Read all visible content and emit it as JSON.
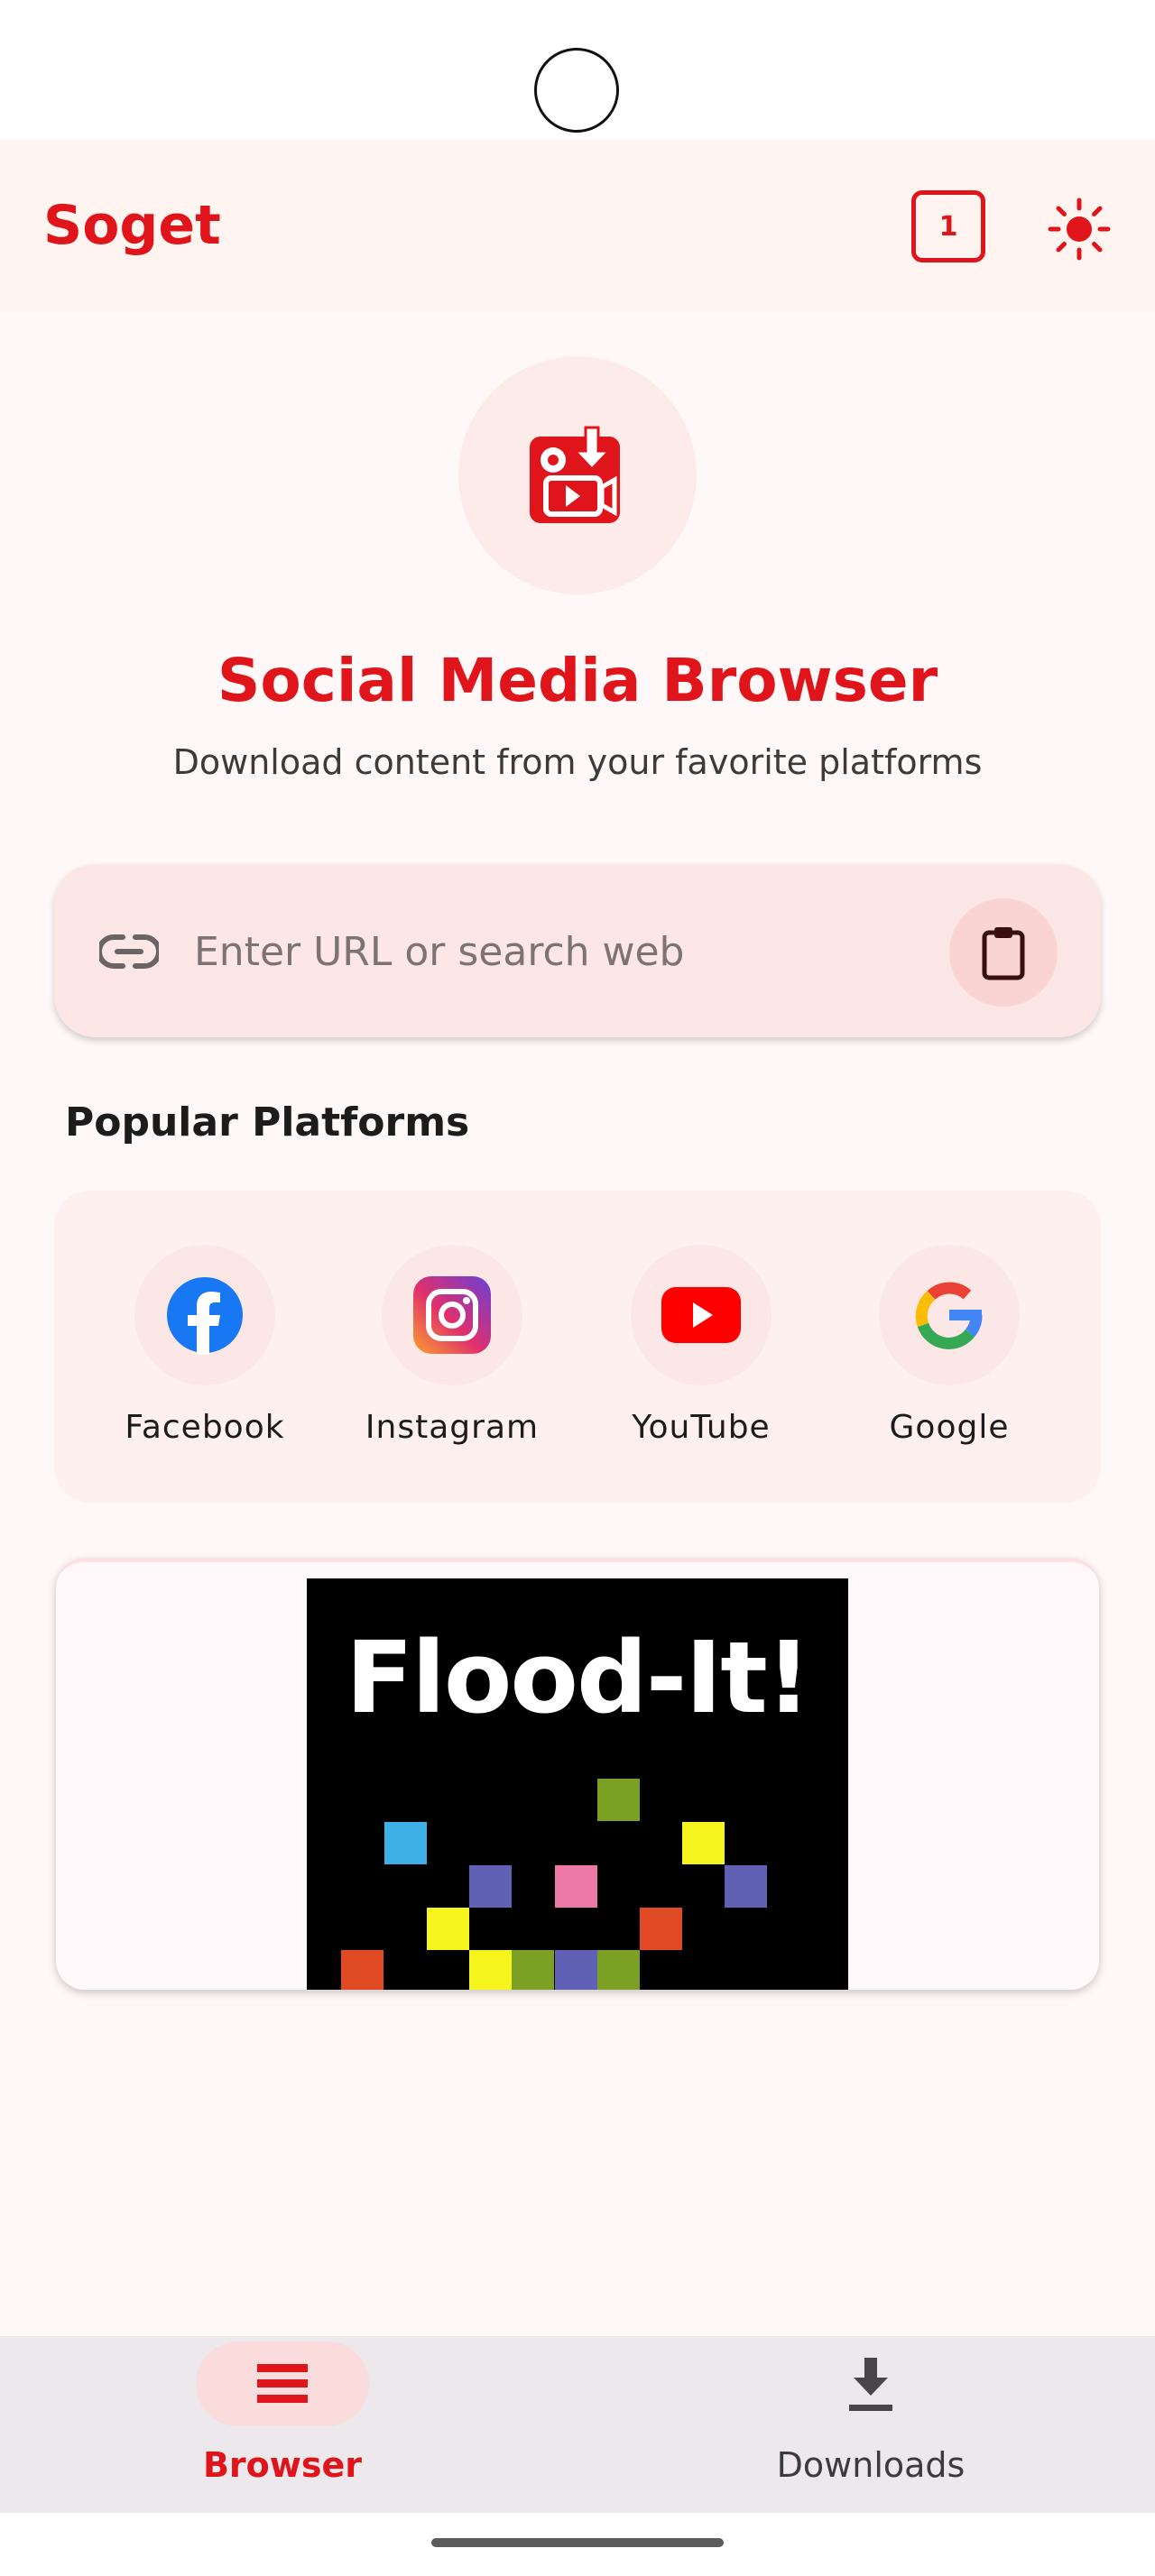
{
  "app": {
    "title": "Soget",
    "tab_count": "1"
  },
  "hero": {
    "title": "Social Media Browser",
    "subtitle": "Download content from your favorite platforms"
  },
  "search": {
    "placeholder": "Enter URL or search web",
    "value": ""
  },
  "platforms": {
    "title": "Popular Platforms",
    "items": [
      {
        "label": "Facebook",
        "icon": "facebook-icon"
      },
      {
        "label": "Instagram",
        "icon": "instagram-icon"
      },
      {
        "label": "YouTube",
        "icon": "youtube-icon"
      },
      {
        "label": "Google",
        "icon": "google-icon"
      }
    ]
  },
  "banner": {
    "text": "Flood-It!"
  },
  "nav": {
    "items": [
      {
        "label": "Browser",
        "icon": "list-icon",
        "active": true
      },
      {
        "label": "Downloads",
        "icon": "download-icon",
        "active": false
      }
    ]
  },
  "colors": {
    "accent": "#e0151b",
    "background": "#fff8f9",
    "app_bar": "#fff4f0",
    "search_bg": "#fde7e6"
  }
}
